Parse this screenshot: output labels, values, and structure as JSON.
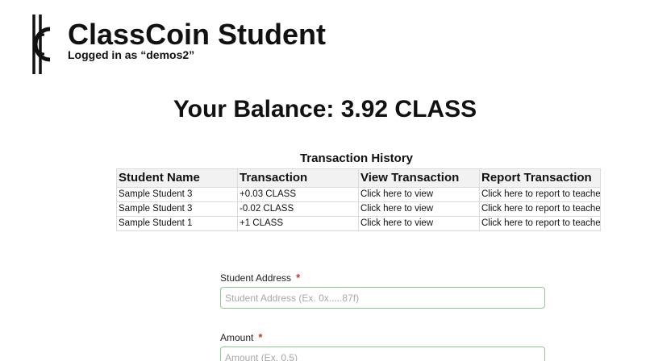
{
  "header": {
    "app_title": "ClassCoin Student",
    "logged_in_text": "Logged in as “demos2”"
  },
  "balance": {
    "text": "Your Balance: 3.92 CLASS"
  },
  "history": {
    "title": "Transaction History",
    "columns": [
      "Student Name",
      "Transaction",
      "View Transaction",
      "Report Transaction"
    ],
    "rows": [
      [
        "Sample Student 3",
        "+0.03 CLASS",
        "Click here to view",
        "Click here to report to teacher"
      ],
      [
        "Sample Student 3",
        "-0.02 CLASS",
        "Click here to view",
        "Click here to report to teacher"
      ],
      [
        "Sample Student 1",
        "+1 CLASS",
        "Click here to view",
        "Click here to report to teacher"
      ]
    ]
  },
  "form": {
    "student_address": {
      "label": "Student Address",
      "required_mark": "*",
      "placeholder": "Student Address (Ex. 0x.....87f)",
      "value": ""
    },
    "amount": {
      "label": "Amount",
      "required_mark": "*",
      "placeholder": "Amount (Ex. 0.5)",
      "value": ""
    }
  },
  "colors": {
    "input_border": "#8fc98f",
    "required": "#c0392b",
    "table_header_bg": "#f2f2f2"
  },
  "icons": {
    "logo": "classcoin-logo-icon"
  }
}
